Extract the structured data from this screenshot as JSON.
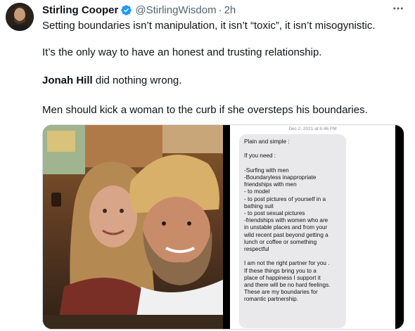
{
  "author": {
    "name": "Stirling Cooper",
    "handle": "@StirlingWisdom",
    "separator": "·",
    "time": "2h",
    "verified": true,
    "avatar_icon": "profile-avatar"
  },
  "more_icon": "more-horizontal-icon",
  "tweet": {
    "line1": "Setting boundaries isn’t manipulation, it isn’t “toxic”, it isn’t misogynistic.",
    "line2": "It’s the only way to have an honest and trusting relationship.",
    "line3_bold": "Jonah Hill",
    "line3_rest": " did nothing wrong.",
    "line4": "Men should kick a woman to the curb if she oversteps his boundaries."
  },
  "media": {
    "screenshot_date": "Dec 2, 2021 at 6:46 PM",
    "message_lines": [
      "Plain and simple :",
      "",
      "If you need :",
      "",
      "-Surfing with men",
      "-Boundaryless inappropriate",
      "friendships with men",
      "- to model",
      "- to post pictures of yourself in a",
      "bathing suit",
      "- to post sexual pictures",
      "-friendships with women who are",
      "in unstable places and from your",
      "wild recent past beyond getting a",
      "lunch or coffee or something",
      "respectful",
      "",
      "I am not the right partner for you .",
      "If these things bring you to a",
      "place of happiness I support it",
      "and there will be no hard feelings.",
      "These are my boundaries for",
      "romantic partnership."
    ]
  },
  "colors": {
    "verified_blue": "#1d9bf0",
    "muted_text": "#536471",
    "text": "#0f1419"
  }
}
